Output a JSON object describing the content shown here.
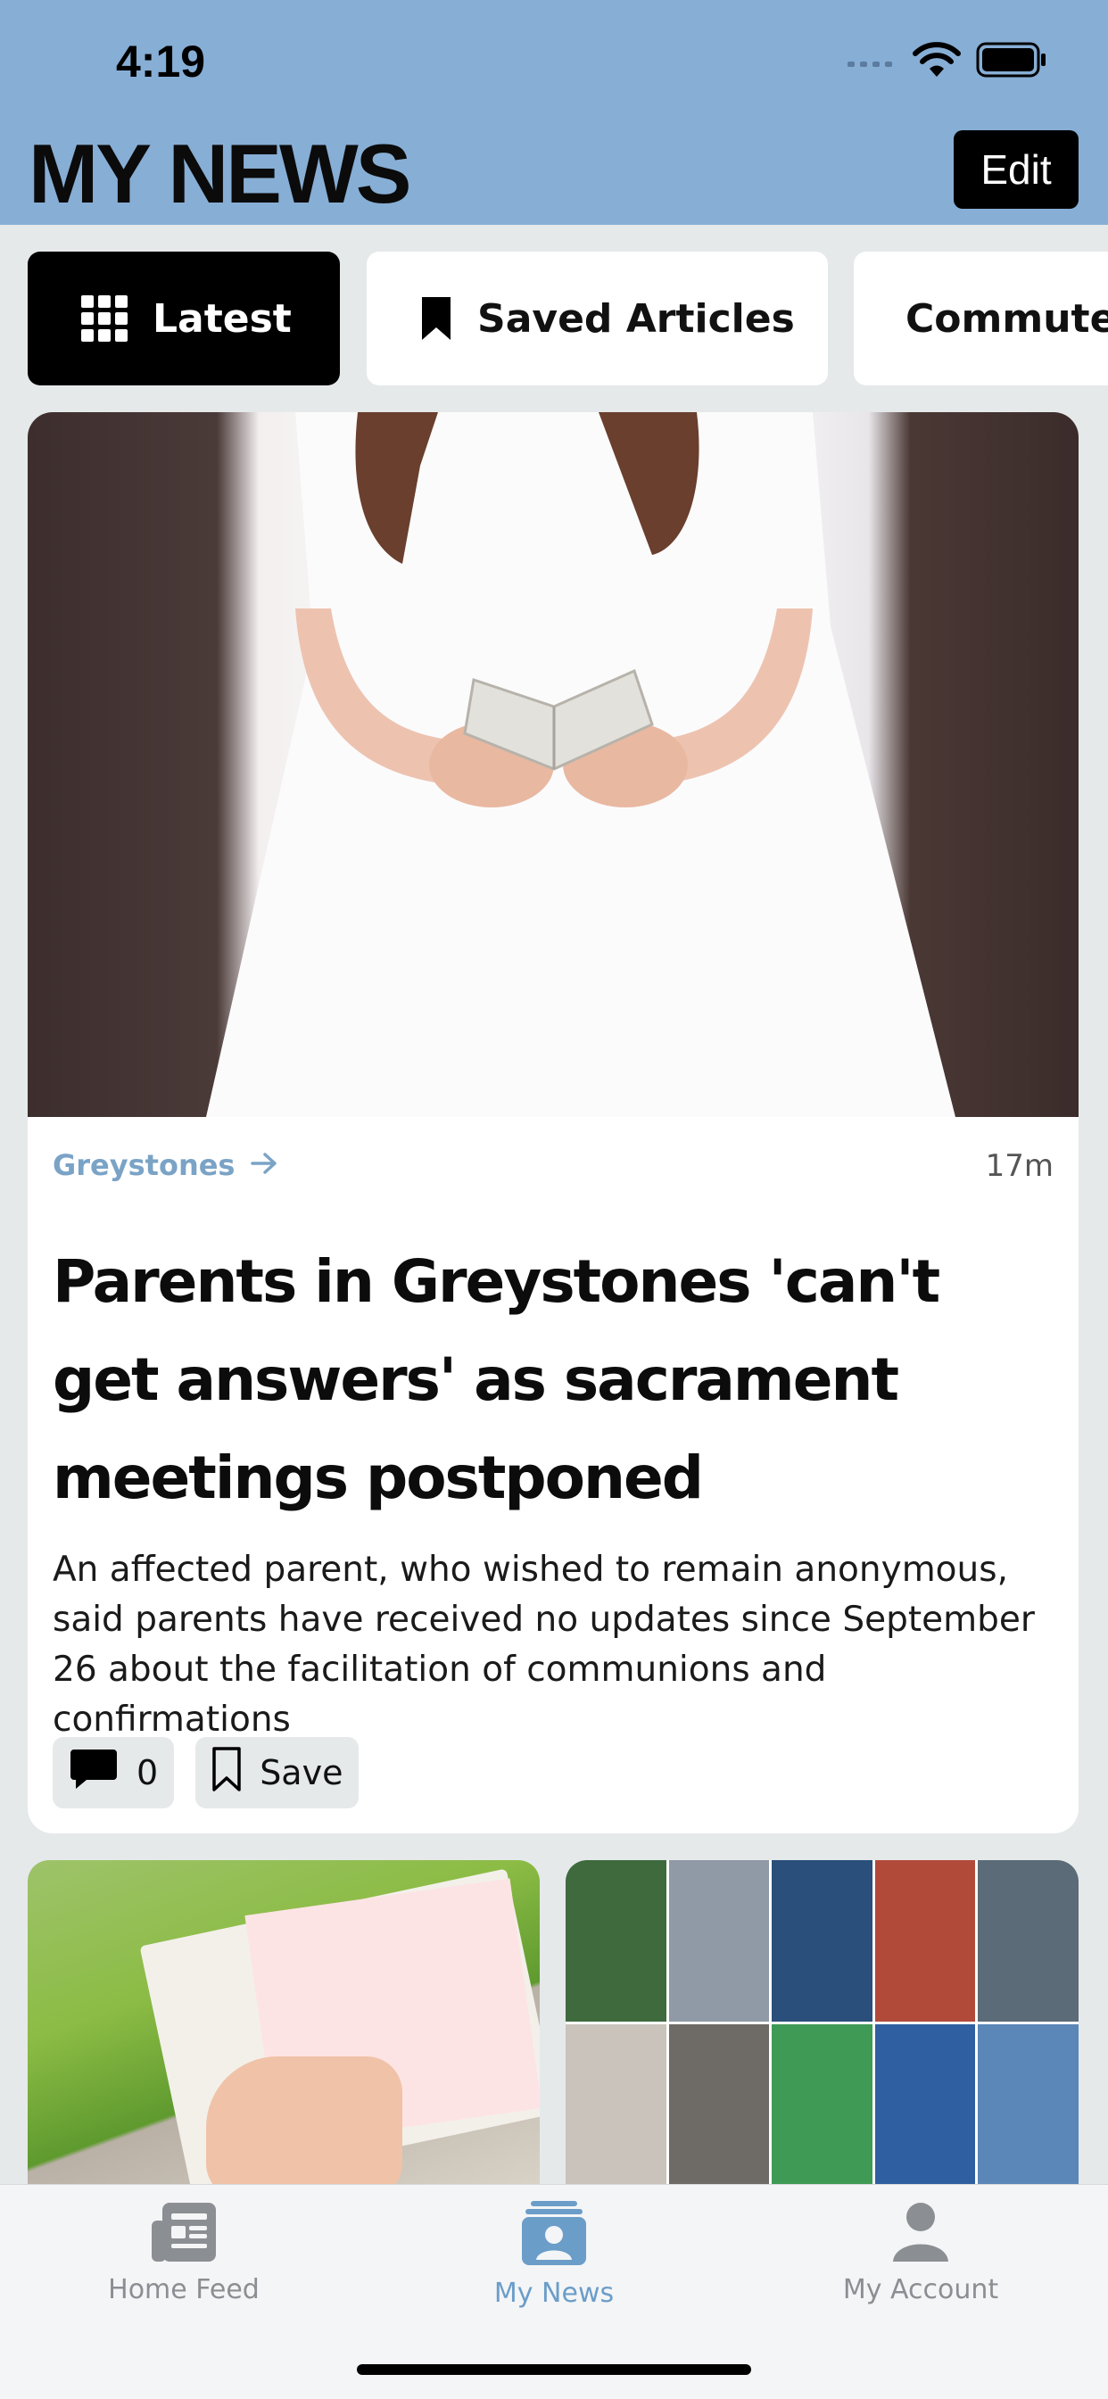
{
  "status_bar": {
    "time": "4:19"
  },
  "header": {
    "title": "MY NEWS",
    "edit_label": "Edit"
  },
  "tabs": [
    {
      "label": "Latest",
      "icon": "grid-icon",
      "active": true
    },
    {
      "label": "Saved Articles",
      "icon": "bookmark-icon",
      "active": false
    },
    {
      "label": "Commute",
      "icon": "",
      "active": false
    }
  ],
  "featured_article": {
    "image_icon": "photo-girl-holding-book",
    "category": "Greystones",
    "time_ago": "17m",
    "headline": "Parents in Greystones 'can't get answers' as sacrament meetings postponed",
    "summary": "An affected parent, who wished to remain anonymous, said parents have received no updates since September 26 about the facilitation of communions and confirmations",
    "comment_count": "0",
    "save_label": "Save"
  },
  "more_articles": [
    {
      "image_icon": "photo-lotto-ticket"
    },
    {
      "image_icon": "photo-collage-portraits"
    }
  ],
  "bottom_nav": [
    {
      "label": "Home Feed",
      "icon": "newspaper-icon",
      "active": false
    },
    {
      "label": "My News",
      "icon": "my-news-icon",
      "active": true
    },
    {
      "label": "My Account",
      "icon": "person-icon",
      "active": false
    }
  ],
  "colors": {
    "header_bg": "#87aed5",
    "page_bg": "#e5e9ea",
    "accent": "#6b9dc9",
    "category_link": "#7aa3c6"
  }
}
